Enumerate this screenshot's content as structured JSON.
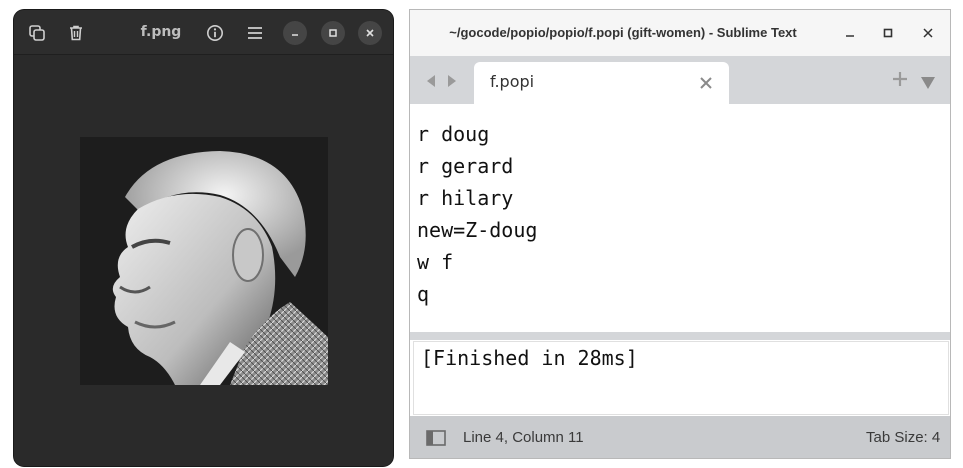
{
  "viewer": {
    "title": "f.png",
    "icons": [
      "copy-icon",
      "trash-icon",
      "info-icon",
      "menu-icon",
      "minimize-icon",
      "maximize-icon",
      "close-icon"
    ],
    "image_alt": "inverted portrait photo"
  },
  "sublime": {
    "title": "~/gocode/popio/popio/f.popi (gift-women) - Sublime Text",
    "tab": {
      "label": "f.popi"
    },
    "code_lines": [
      "r doug",
      "r gerard",
      "r hilary",
      "new=Z-doug",
      "w f",
      "q"
    ],
    "output": "[Finished in 28ms]",
    "status": {
      "position": "Line 4, Column 11",
      "tab_size": "Tab Size: 4"
    }
  },
  "colors": {
    "viewer_bg": "#2a2a2a",
    "tabbar_bg": "#d4d6d9",
    "statusbar_bg": "#c9cbce"
  }
}
